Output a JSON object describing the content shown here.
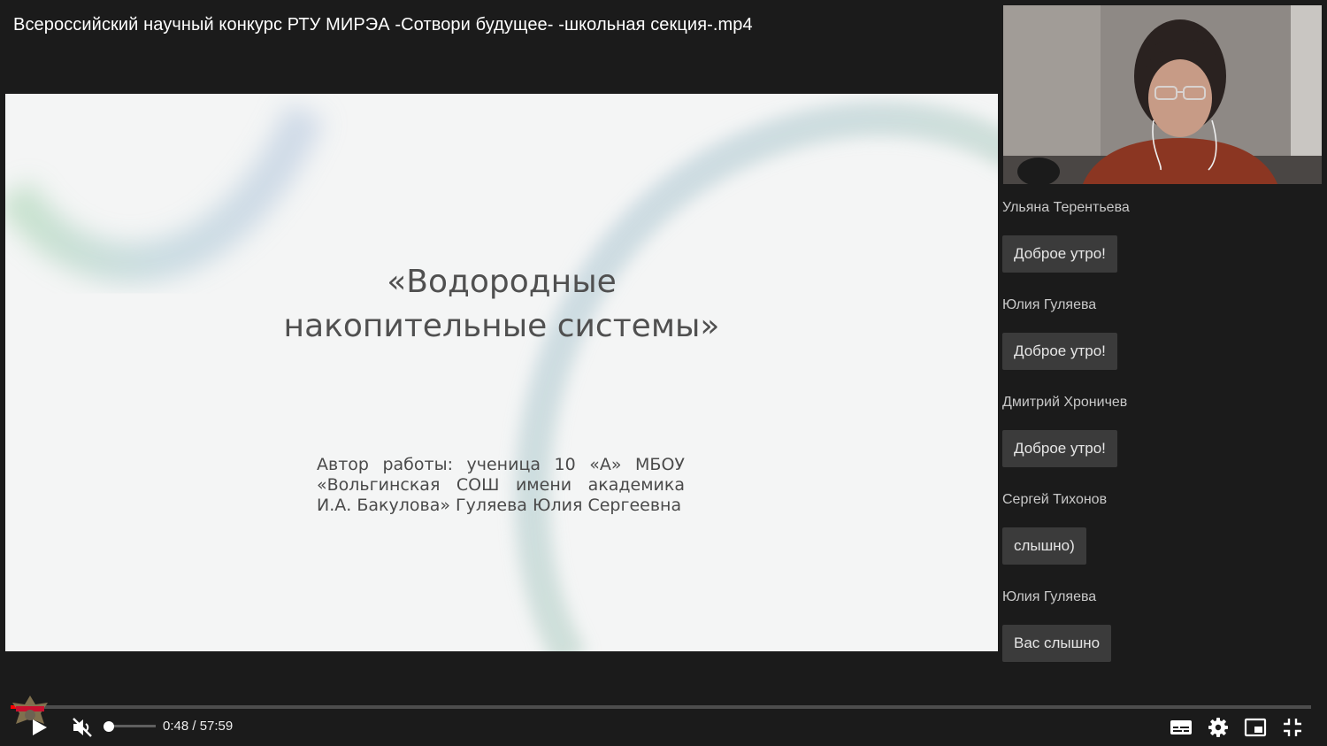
{
  "video": {
    "title": "Всероссийский научный конкурс РТУ МИРЭА -Сотвори будущее- -школьная секция-.mp4"
  },
  "slide": {
    "title_lines": [
      "«Водородные",
      "накопительные системы»"
    ],
    "author_lines": [
      "Автор работы: ученица 10 «А» МБОУ",
      "«Вольгинская СОШ имени академика",
      "И.А. Бакулова» Гуляева Юлия Сергеевна"
    ]
  },
  "chat": {
    "messages": [
      {
        "author": "Ульяна Терентьева",
        "text": "Доброе утро!"
      },
      {
        "author": "Юлия Гуляева",
        "text": "Доброе утро!"
      },
      {
        "author": "Дмитрий Хроничев",
        "text": "Доброе утро!"
      },
      {
        "author": "Сергей Тихонов",
        "text": "слышно)"
      },
      {
        "author": "Юлия Гуляева",
        "text": "Вас слышно"
      }
    ]
  },
  "player": {
    "time_current": "0:48",
    "time_total": "57:59",
    "time_display": "0:48 / 57:59",
    "progress_fraction": 0.0138,
    "volume_fraction": 0.0,
    "muted": true,
    "accent_color": "#ff0000",
    "icons": [
      "play-icon",
      "volume-muted-icon",
      "subtitles-icon",
      "settings-gear-icon",
      "miniplayer-icon",
      "exit-fullscreen-icon"
    ]
  }
}
